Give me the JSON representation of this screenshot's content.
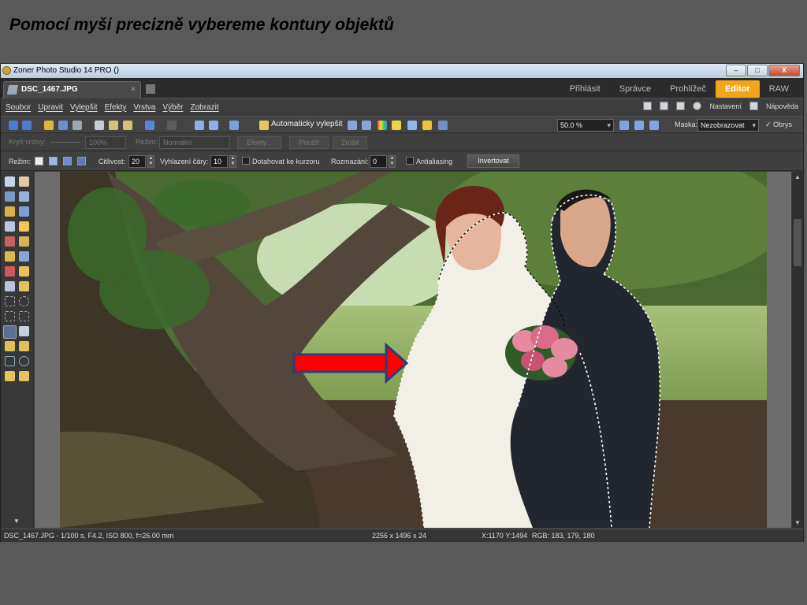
{
  "slide": {
    "title": "Pomocí myši precizně vybereme  kontury  objektů"
  },
  "window": {
    "title": "Zoner Photo Studio 14 PRO  ()",
    "buttons": {
      "minimize": "–",
      "maximize": "□",
      "close": "X"
    }
  },
  "tabs": {
    "document": "DSC_1467.JPG",
    "close": "×",
    "modes": [
      "Přihlásit",
      "Správce",
      "Prohlížeč",
      "Editor",
      "RAW"
    ],
    "active_mode": "Editor"
  },
  "menu": {
    "items": [
      "Soubor",
      "Upravit",
      "Vylepšit",
      "Efekty",
      "Vrstva",
      "Výběr",
      "Zobrazit"
    ],
    "settings": "Nastavení",
    "help": "Nápověda"
  },
  "toolbar1": {
    "auto_enhance": "Automaticky vylepšit",
    "zoom": "50.0 %",
    "mask_label": "Maska:",
    "mask_value": "Nezobrazovat",
    "outline": "✓ Obrys"
  },
  "toolbar2": {
    "cover_label": "Krytí vrstvy:",
    "cover_value": "100%",
    "mode_label": "Režim:",
    "mode_value": "Normální",
    "effects": "Efekty...",
    "apply": "Použít",
    "cancel": "Zrušit"
  },
  "toolbar3": {
    "mode_label": "Režim:",
    "sensitivity_label": "Citlivost:",
    "sensitivity_value": "20",
    "smoothing_label": "Vyhlazení čáry:",
    "smoothing_value": "10",
    "snap_label": "Dotahovat ke kurzoru",
    "blur_label": "Rozmazání:",
    "blur_value": "0",
    "antialias_label": "Antialiasing",
    "invert": "Invertovat"
  },
  "status": {
    "file_info": "DSC_1467.JPG - 1/100 s, F4.2, ISO 800, f=26.00 mm",
    "dimensions": "2256 x 1496 x 24",
    "cursor": "X:1170 Y:1494",
    "rgb": "RGB: 183, 179, 180"
  },
  "colors": {
    "accent": "#f2a51a",
    "arrow": "#ff0000",
    "arrow_outline": "#2a3f7a"
  }
}
